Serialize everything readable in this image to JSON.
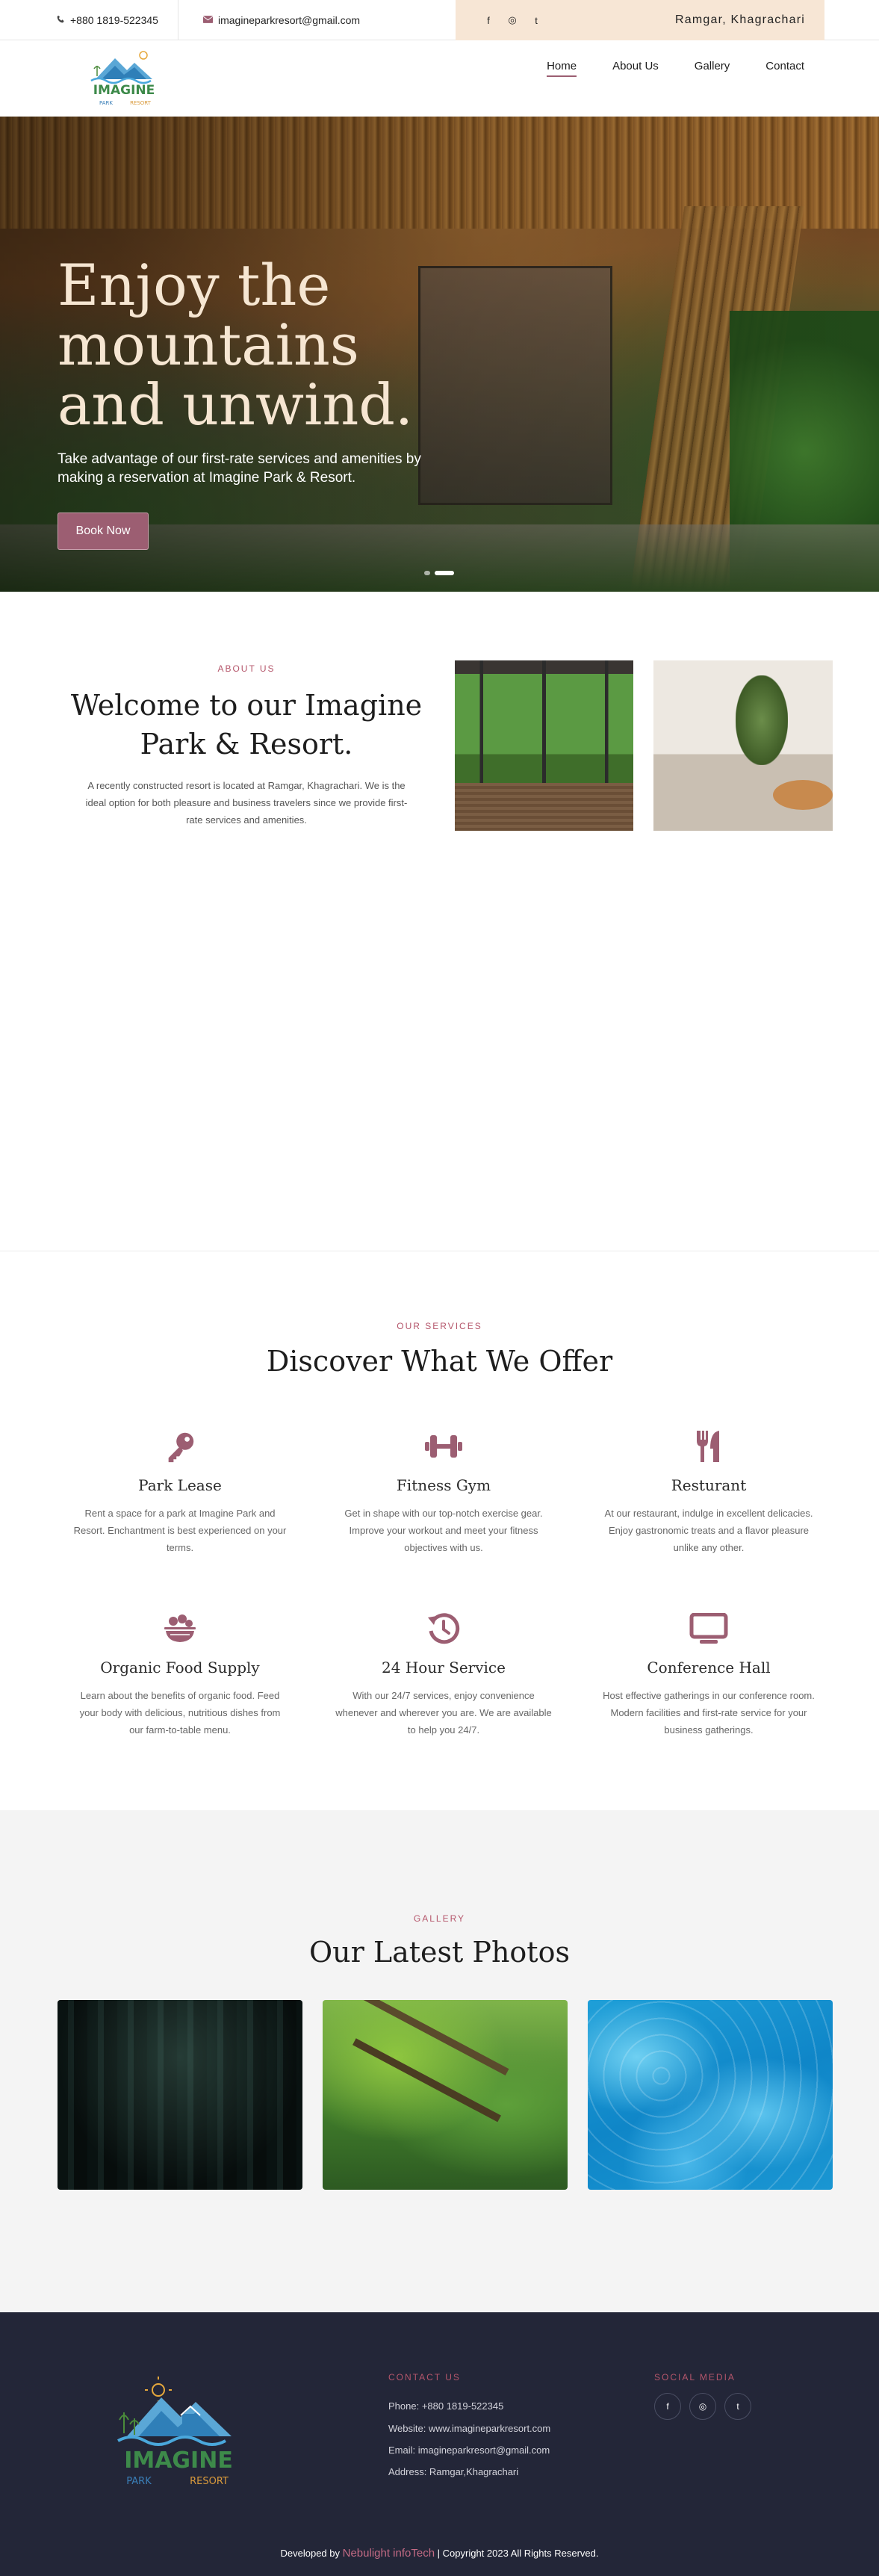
{
  "topbar": {
    "phone": "+880 1819-522345",
    "email": "imagineparkresort@gmail.com",
    "social": [
      "f",
      "◎",
      "t"
    ],
    "location": "Ramgar, Khagrachari"
  },
  "brand": {
    "logo_line1": "IMAGINE",
    "logo_park": "PARK",
    "logo_resort": "RESORT"
  },
  "nav": {
    "items": [
      {
        "label": "Home",
        "active": true
      },
      {
        "label": "About Us",
        "active": false
      },
      {
        "label": "Gallery",
        "active": false
      },
      {
        "label": "Contact",
        "active": false
      }
    ]
  },
  "hero": {
    "title": "Enjoy the mountains and unwind.",
    "subtitle": "Take advantage of our first-rate services and amenities by making a reservation at Imagine Park & Resort.",
    "button": "Book Now",
    "slides": 2,
    "active_slide": 2
  },
  "about": {
    "kicker": "ABOUT US",
    "title": "Welcome to our Imagine Park & Resort.",
    "text": "A recently constructed resort is located at Ramgar, Khagrachari. We is the ideal option for both pleasure and business travelers since we provide first-rate services and amenities."
  },
  "services": {
    "kicker": "OUR SERVICES",
    "title": "Discover What We Offer",
    "items": [
      {
        "name": "Park Lease",
        "icon": "key-icon",
        "desc": "Rent a space for a park at Imagine Park and Resort. Enchantment is best experienced on your terms."
      },
      {
        "name": "Fitness Gym",
        "icon": "dumbbell-icon",
        "desc": "Get in shape with our top-notch exercise gear. Improve your workout and meet your fitness objectives with us."
      },
      {
        "name": "Resturant",
        "icon": "utensils-icon",
        "desc": "At our restaurant, indulge in excellent delicacies. Enjoy gastronomic treats and a flavor pleasure unlike any other."
      },
      {
        "name": "Organic Food Supply",
        "icon": "food-bowl-icon",
        "desc": "Learn about the benefits of organic food. Feed your body with delicious, nutritious dishes from our farm-to-table menu."
      },
      {
        "name": "24 Hour Service",
        "icon": "history-icon",
        "desc": "With our 24/7 services, enjoy convenience whenever and wherever you are. We are available to help you 24/7."
      },
      {
        "name": "Conference Hall",
        "icon": "monitor-icon",
        "desc": "Host effective gatherings in our conference room. Modern facilities and first-rate service for your business gatherings."
      }
    ]
  },
  "gallery": {
    "kicker": "GALLERY",
    "title": "Our Latest Photos"
  },
  "footer": {
    "contact_title": "CONTACT US",
    "phone": "Phone: +880 1819-522345",
    "website": "Website: www.imagineparkresort.com",
    "email": "Email: imagineparkresort@gmail.com",
    "address": "Address: Ramgar,Khagrachari",
    "social_title": "SOCIAL MEDIA",
    "social": [
      "f",
      "◎",
      "t"
    ],
    "copy_prefix": "Developed by",
    "copy_brand": "Nebulight infoTech",
    "copy_suffix": "| Copyright 2023 All Rights Reserved."
  },
  "colors": {
    "accent": "#9c5e72",
    "kicker": "#b5566b",
    "topbar_right": "#f7e6d5",
    "footer_bg": "#232638"
  }
}
